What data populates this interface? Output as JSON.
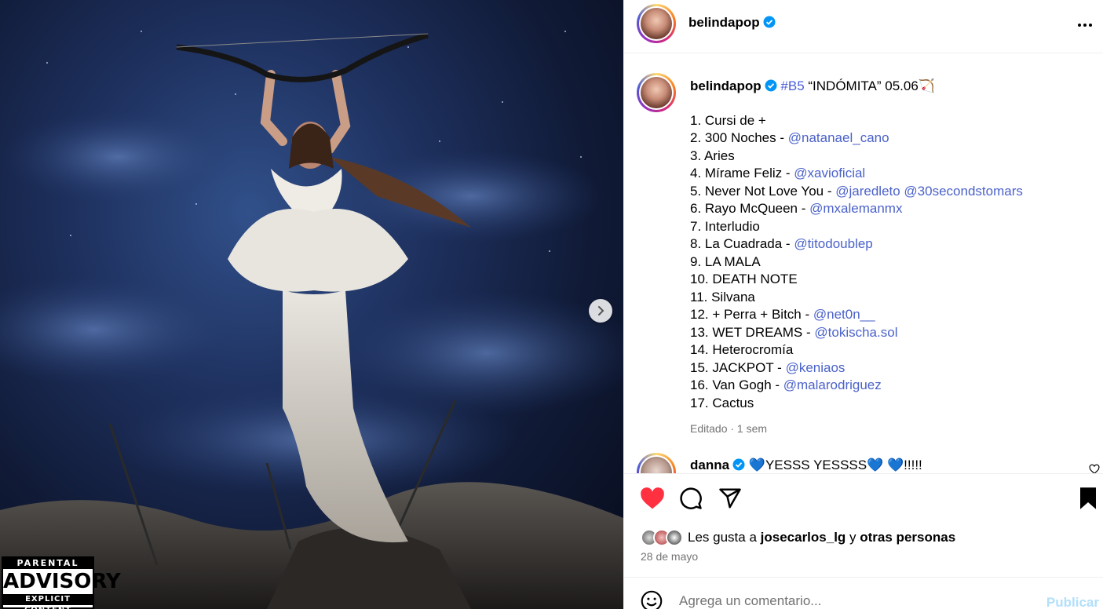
{
  "media": {
    "next_icon": "chevron-right-icon",
    "advisory": {
      "line1": "PARENTAL",
      "line2": "ADVISORY",
      "line3": "EXPLICIT CONTENT"
    }
  },
  "header": {
    "username": "belindapop",
    "verified_icon": "verified-badge-icon",
    "more_icon": "more-options-icon"
  },
  "caption": {
    "username": "belindapop",
    "hashtag": "#B5",
    "title": " “INDÓMITA” 05.06🏹",
    "tracks": [
      {
        "text": "1. Cursi de +",
        "mentions": ""
      },
      {
        "text": "2. 300 Noches - ",
        "mentions": "@natanael_cano"
      },
      {
        "text": "3. Aries",
        "mentions": ""
      },
      {
        "text": "4. Mírame Feliz - ",
        "mentions": "@xavioficial"
      },
      {
        "text": "5. Never Not Love You - ",
        "mentions": "@jaredleto @30secondstomars"
      },
      {
        "text": "6. Rayo McQueen - ",
        "mentions": "@mxalemanmx"
      },
      {
        "text": "7. Interludio",
        "mentions": ""
      },
      {
        "text": "8. La Cuadrada - ",
        "mentions": "@titodoublep"
      },
      {
        "text": "9. LA MALA",
        "mentions": ""
      },
      {
        "text": "10. DEATH NOTE",
        "mentions": ""
      },
      {
        "text": "11. Silvana",
        "mentions": ""
      },
      {
        "text": "12. + Perra + Bitch - ",
        "mentions": "@net0n__"
      },
      {
        "text": "13. WET DREAMS - ",
        "mentions": "@tokischa.sol"
      },
      {
        "text": "14. Heterocromía",
        "mentions": ""
      },
      {
        "text": "15. JACKPOT - ",
        "mentions": "@keniaos"
      },
      {
        "text": "16. Van Gogh - ",
        "mentions": "@malarodriguez"
      },
      {
        "text": "17. Cactus",
        "mentions": ""
      }
    ],
    "meta": "Editado · 1 sem"
  },
  "comment": {
    "username": "danna",
    "text": " 💙YESSS YESSSS💙 💙!!!!!"
  },
  "actions": {
    "like_icon": "heart-filled-icon",
    "comment_icon": "comment-icon",
    "share_icon": "share-icon",
    "save_icon": "bookmark-icon",
    "like_color": "#ff3040"
  },
  "likes": {
    "prefix": "Les gusta a ",
    "user": "josecarlos_lg",
    "middle": " y ",
    "others": "otras personas"
  },
  "date": "28 de mayo",
  "add_comment": {
    "placeholder": "Agrega un comentario...",
    "post_label": "Publicar",
    "emoji_icon": "emoji-icon"
  }
}
